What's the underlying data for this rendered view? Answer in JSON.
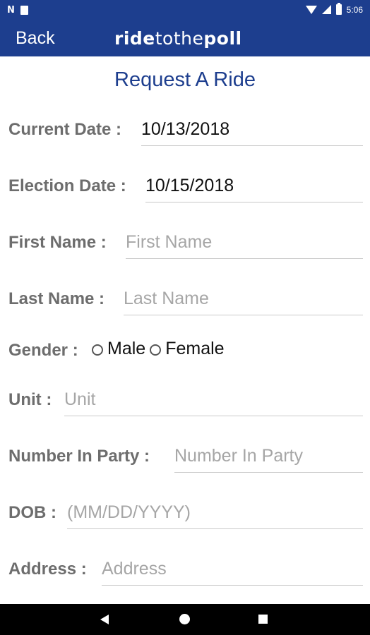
{
  "status_bar": {
    "left_icons": [
      "nfc-icon",
      "sim-card-icon"
    ],
    "right_icons": [
      "wifi-icon",
      "signal-icon",
      "battery-icon"
    ],
    "time": "5:06"
  },
  "app_bar": {
    "back_label": "Back",
    "logo_part1": "ride",
    "logo_part2": "tothe",
    "logo_part3": "poll",
    "background": "#1d3e8e"
  },
  "page": {
    "title": "Request A Ride",
    "title_color": "#1d3e8e"
  },
  "form": {
    "current_date": {
      "label": "Current Date :",
      "value": "10/13/2018",
      "placeholder": ""
    },
    "election_date": {
      "label": "Election Date :",
      "value": "10/15/2018",
      "placeholder": ""
    },
    "first_name": {
      "label": "First Name :",
      "value": "",
      "placeholder": "First Name"
    },
    "last_name": {
      "label": "Last Name :",
      "value": "",
      "placeholder": "Last Name"
    },
    "gender": {
      "label": "Gender :",
      "options": [
        "Male",
        "Female"
      ]
    },
    "unit": {
      "label": "Unit :",
      "value": "",
      "placeholder": "Unit"
    },
    "number_in_party": {
      "label": "Number In Party :",
      "value": "",
      "placeholder": "Number In Party"
    },
    "dob": {
      "label": "DOB :",
      "value": "",
      "placeholder": "(MM/DD/YYYY)"
    },
    "address": {
      "label": "Address :",
      "value": "",
      "placeholder": "Address"
    }
  },
  "nav_bar": {
    "icons": [
      "nav-back-icon",
      "nav-home-icon",
      "nav-recents-icon"
    ]
  }
}
